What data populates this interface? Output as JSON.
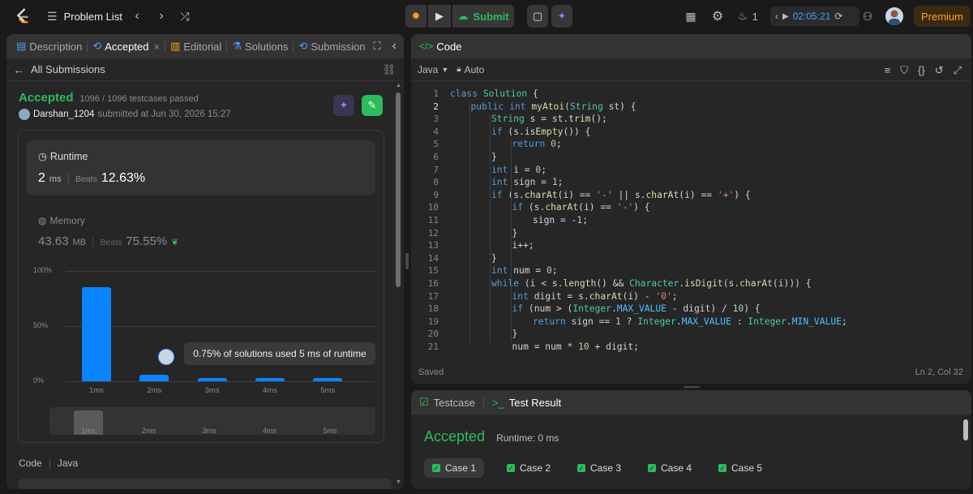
{
  "topbar": {
    "problem_list_label": "Problem List",
    "submit_label": "Submit",
    "streak_count": "1",
    "timer": "02:05:21",
    "premium_label": "Premium",
    "icons": [
      "logo-icon",
      "list-icon",
      "chevron-left-icon",
      "chevron-right-icon",
      "shuffle-icon",
      "debug-icon",
      "play-icon",
      "cloud-upload-icon",
      "note-icon",
      "sparkle-icon",
      "layout-icon",
      "gear-icon",
      "fire-icon",
      "chevron-left-icon",
      "play-icon",
      "reset-icon",
      "add-user-icon",
      "avatar"
    ]
  },
  "left_tabs": [
    {
      "label": "Description",
      "icon": "description-icon"
    },
    {
      "label": "Accepted",
      "icon": "history-icon",
      "active": true
    },
    {
      "label": "Editorial",
      "icon": "book-icon"
    },
    {
      "label": "Solutions",
      "icon": "flask-icon"
    },
    {
      "label": "Submission",
      "icon": "history-icon"
    }
  ],
  "submission": {
    "back_label": "All Submissions",
    "status": "Accepted",
    "testcases": "1096 / 1096 testcases passed",
    "user": "Darshan_1204",
    "submitted_at": "submitted at Jun 30, 2026 15:27",
    "runtime_label": "Runtime",
    "runtime_value": "2",
    "runtime_unit": "ms",
    "beats_label": "Beats",
    "runtime_beats": "12.63%",
    "memory_label": "Memory",
    "memory_value": "43.63",
    "memory_unit": "MB",
    "memory_beats": "75.55%",
    "tooltip": "0.75% of solutions used 5 ms of runtime",
    "code_label": "Code",
    "code_lang": "Java"
  },
  "chart_data": {
    "type": "bar",
    "categories": [
      "1ms",
      "2ms",
      "3ms",
      "4ms",
      "5ms"
    ],
    "values": [
      85,
      6,
      3,
      3,
      3
    ],
    "y_ticks": [
      "100%",
      "50%",
      "0%"
    ],
    "ylim": [
      0,
      100
    ],
    "color": "#0a84ff",
    "grid": true
  },
  "code": {
    "tab_label": "Code",
    "language": "Java",
    "mode": "Auto",
    "saved_label": "Saved",
    "cursor": "Ln 2, Col 32"
  },
  "test": {
    "testcase_label": "Testcase",
    "result_label": "Test Result",
    "status": "Accepted",
    "runtime": "Runtime: 0 ms",
    "cases": [
      "Case 1",
      "Case 2",
      "Case 3",
      "Case 4",
      "Case 5"
    ]
  },
  "colors": {
    "accent_green": "#2cbb5d",
    "accent_orange": "#ffa116",
    "bar_blue": "#0a84ff",
    "timer_blue": "#4c9dff"
  }
}
